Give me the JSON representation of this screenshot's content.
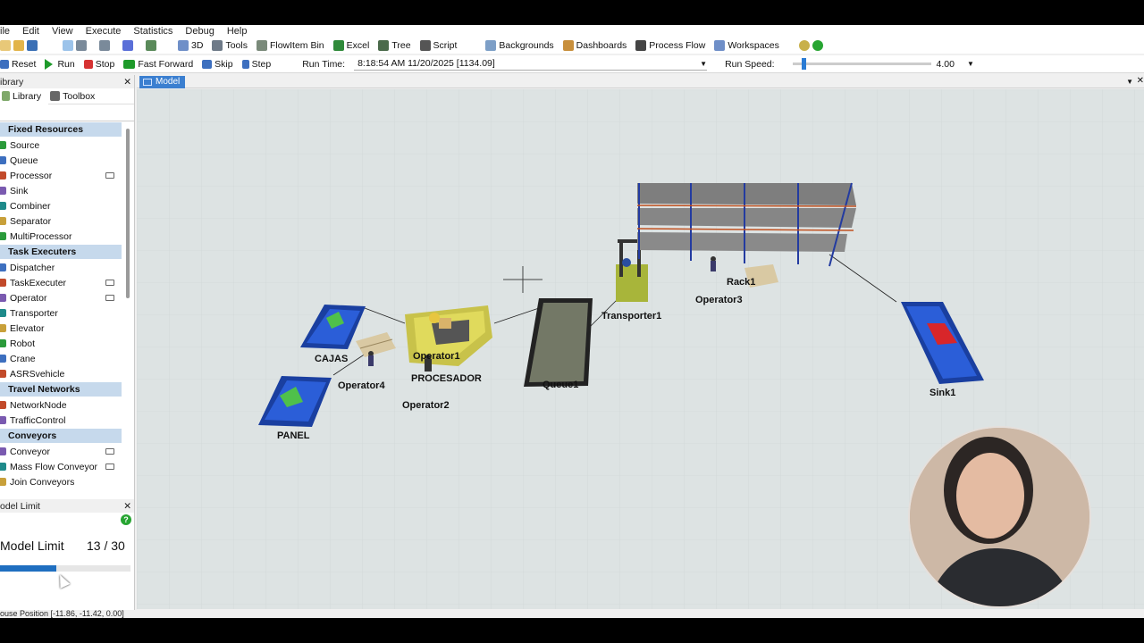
{
  "menu": [
    "ile",
    "Edit",
    "View",
    "Execute",
    "Statistics",
    "Debug",
    "Help"
  ],
  "toolbar": {
    "items": [
      "3D",
      "Tools",
      "FlowItem Bin",
      "Excel",
      "Tree",
      "Script",
      "Backgrounds",
      "Dashboards",
      "Process Flow",
      "Workspaces"
    ]
  },
  "run": {
    "reset": "Reset",
    "run": "Run",
    "stop": "Stop",
    "fast_forward": "Fast Forward",
    "skip": "Skip",
    "step": "Step",
    "run_time_label": "Run Time:",
    "run_time_value": "8:18:54 AM  11/20/2025  [1134.09]",
    "run_speed_label": "Run Speed:",
    "run_speed_value": "4.00"
  },
  "library": {
    "title": "ibrary",
    "tabs": [
      "Library",
      "Toolbox"
    ],
    "categories": [
      {
        "name": "Fixed Resources",
        "items": [
          "Source",
          "Queue",
          "Processor",
          "Sink",
          "Combiner",
          "Separator",
          "MultiProcessor"
        ]
      },
      {
        "name": "Task Executers",
        "items": [
          "Dispatcher",
          "TaskExecuter",
          "Operator",
          "Transporter",
          "Elevator",
          "Robot",
          "Crane",
          "ASRSvehicle"
        ]
      },
      {
        "name": "Travel Networks",
        "items": [
          "NetworkNode",
          "TrafficControl"
        ]
      },
      {
        "name": "Conveyors",
        "items": [
          "Conveyor",
          "Mass Flow Conveyor",
          "Join Conveyors"
        ]
      }
    ]
  },
  "model_limit": {
    "title": "odel Limit",
    "label": "Model Limit",
    "count": "13 / 30",
    "progress": 0.433
  },
  "status": {
    "mouse_position": "ouse Position [-11.86, -11.42, 0.00]"
  },
  "model": {
    "tab": "Model",
    "objects": {
      "cajas": "CAJAS",
      "panel": "PANEL",
      "operator1": "Operator1",
      "operator2": "Operator2",
      "operator3": "Operator3",
      "operator4": "Operator4",
      "procesador": "PROCESADOR",
      "queue1": "Queue1",
      "transporter1": "Transporter1",
      "rack1": "Rack1",
      "sink1": "Sink1"
    }
  }
}
